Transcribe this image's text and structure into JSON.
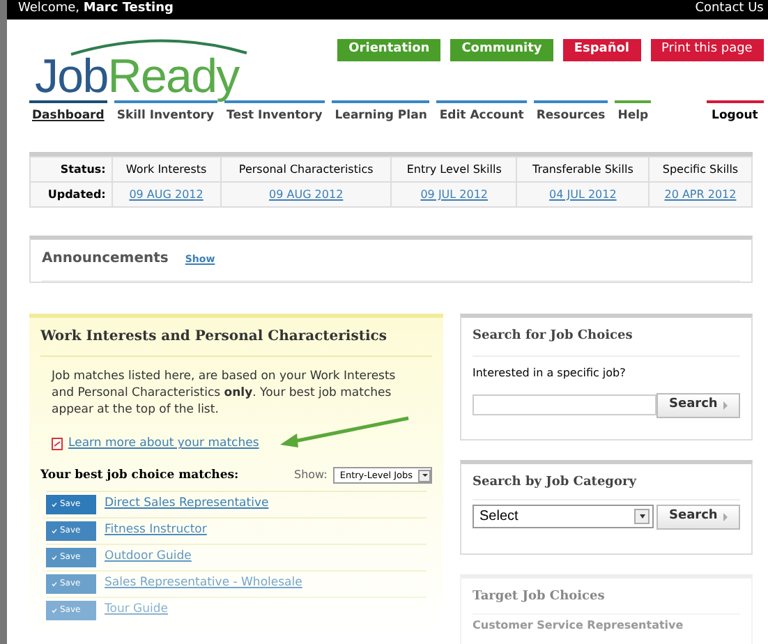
{
  "top_bar": {
    "welcome": "Welcome, **Marc Testing**",
    "contact": "Contact Us"
  },
  "logo": {
    "part_1": "Job",
    "part_2": "Ready"
  },
  "header_buttons": [
    {
      "label": "Orientation",
      "color": "#4a9e2a"
    },
    {
      "label": "Community",
      "color": "#4a9e2a"
    },
    {
      "label": "Español",
      "color": "#d4193a"
    },
    {
      "label": "Print this page",
      "color": "#d4193a"
    }
  ],
  "nav": [
    {
      "label": "Dashboard",
      "selected": true,
      "color": "#1d4e73"
    },
    {
      "label": "Skill Inventory",
      "selected": false,
      "color": "#3a87c4"
    },
    {
      "label": "Test Inventory",
      "selected": false,
      "color": "#3a87c4"
    },
    {
      "label": "Learning Plan",
      "selected": false,
      "color": "#3a87c4"
    },
    {
      "label": "Edit Account",
      "selected": false,
      "color": "#3a87c4"
    },
    {
      "label": "Resources",
      "selected": false,
      "color": "#3a87c4"
    },
    {
      "label": "Help",
      "selected": false,
      "color": "#5aa83a"
    }
  ],
  "logout": {
    "label": "Logout",
    "color": "#d4193a"
  },
  "status_table": {
    "status_label": "Status:",
    "updated_label": "Updated:",
    "columns": [
      {
        "name": "Work Interests",
        "updated": "09 AUG 2012"
      },
      {
        "name": "Personal Characteristics",
        "updated": "09 AUG 2012"
      },
      {
        "name": "Entry Level Skills",
        "updated": "09 JUL 2012"
      },
      {
        "name": "Transferable Skills",
        "updated": "04 JUL 2012"
      },
      {
        "name": "Specific Skills",
        "updated": "20 APR 2012"
      }
    ]
  },
  "announcements": {
    "title": "Announcements",
    "toggle": "Show"
  },
  "matches_panel": {
    "title": "Work Interests and Personal Characteristics",
    "description": "Job matches listed here, are based on your Work Interests and Personal Characteristics **only**. Your best job matches appear at the top of the list.",
    "learn_more": "Learn more about your matches",
    "list_label": "Your best job choice matches:",
    "show_label": "Show:",
    "show_value": "Entry-Level Jobs",
    "jobs": [
      {
        "save": "Save",
        "title": "Direct Sales Representative"
      },
      {
        "save": "Save",
        "title": "Fitness Instructor"
      },
      {
        "save": "Save",
        "title": "Outdoor Guide"
      },
      {
        "save": "Save",
        "title": "Sales Representative - Wholesale"
      },
      {
        "save": "Save",
        "title": "Tour Guide"
      }
    ]
  },
  "job_search": {
    "title": "Search for Job Choices",
    "prompt": "Interested in a specific job?",
    "button": "Search"
  },
  "category_search": {
    "title": "Search by Job Category",
    "select_value": "Select",
    "button": "Search"
  },
  "target_jobs": {
    "title": "Target Job Choices",
    "items": [
      "Customer Service Representative"
    ]
  }
}
